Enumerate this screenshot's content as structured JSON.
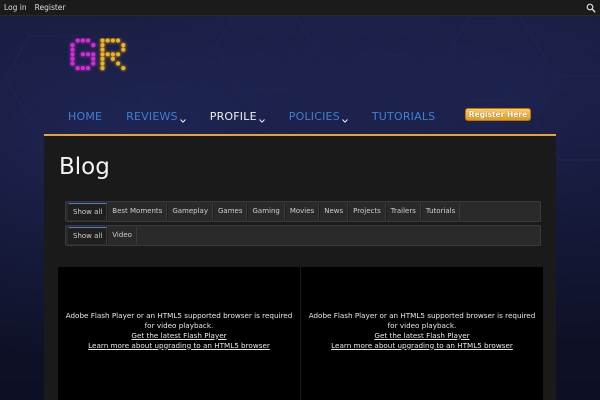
{
  "topbar": {
    "login": "Log in",
    "register": "Register",
    "search_icon": "search-icon"
  },
  "logo": {
    "text": "GR",
    "colors": [
      "#d62bd6",
      "#f0b21b"
    ]
  },
  "nav": {
    "items": [
      {
        "label": "HOME",
        "has_dropdown": false
      },
      {
        "label": "REVIEWS",
        "has_dropdown": true
      },
      {
        "label": "PROFILE",
        "has_dropdown": true,
        "active": true
      },
      {
        "label": "POLICIES",
        "has_dropdown": true
      },
      {
        "label": "TUTORIALS",
        "has_dropdown": false
      }
    ],
    "register_button": "Register Here",
    "accent": "#e6a33a",
    "link_color": "#3e7fd6"
  },
  "page": {
    "title": "Blog",
    "filters_row1": [
      "Show all",
      "Best Moments",
      "Gameplay",
      "Games",
      "Gaming",
      "Movies",
      "News",
      "Projects",
      "Trailers",
      "Tutorials"
    ],
    "filters_row2": [
      "Show all",
      "Video"
    ],
    "videos": [
      {
        "message": "Adobe Flash Player or an HTML5 supported browser is required for video playback.",
        "link1": "Get the latest Flash Player",
        "link2": "Learn more about upgrading to an HTML5 browser"
      },
      {
        "message": "Adobe Flash Player or an HTML5 supported browser is required for video playback.",
        "link1": "Get the latest Flash Player",
        "link2": "Learn more about upgrading to an HTML5 browser"
      }
    ]
  }
}
